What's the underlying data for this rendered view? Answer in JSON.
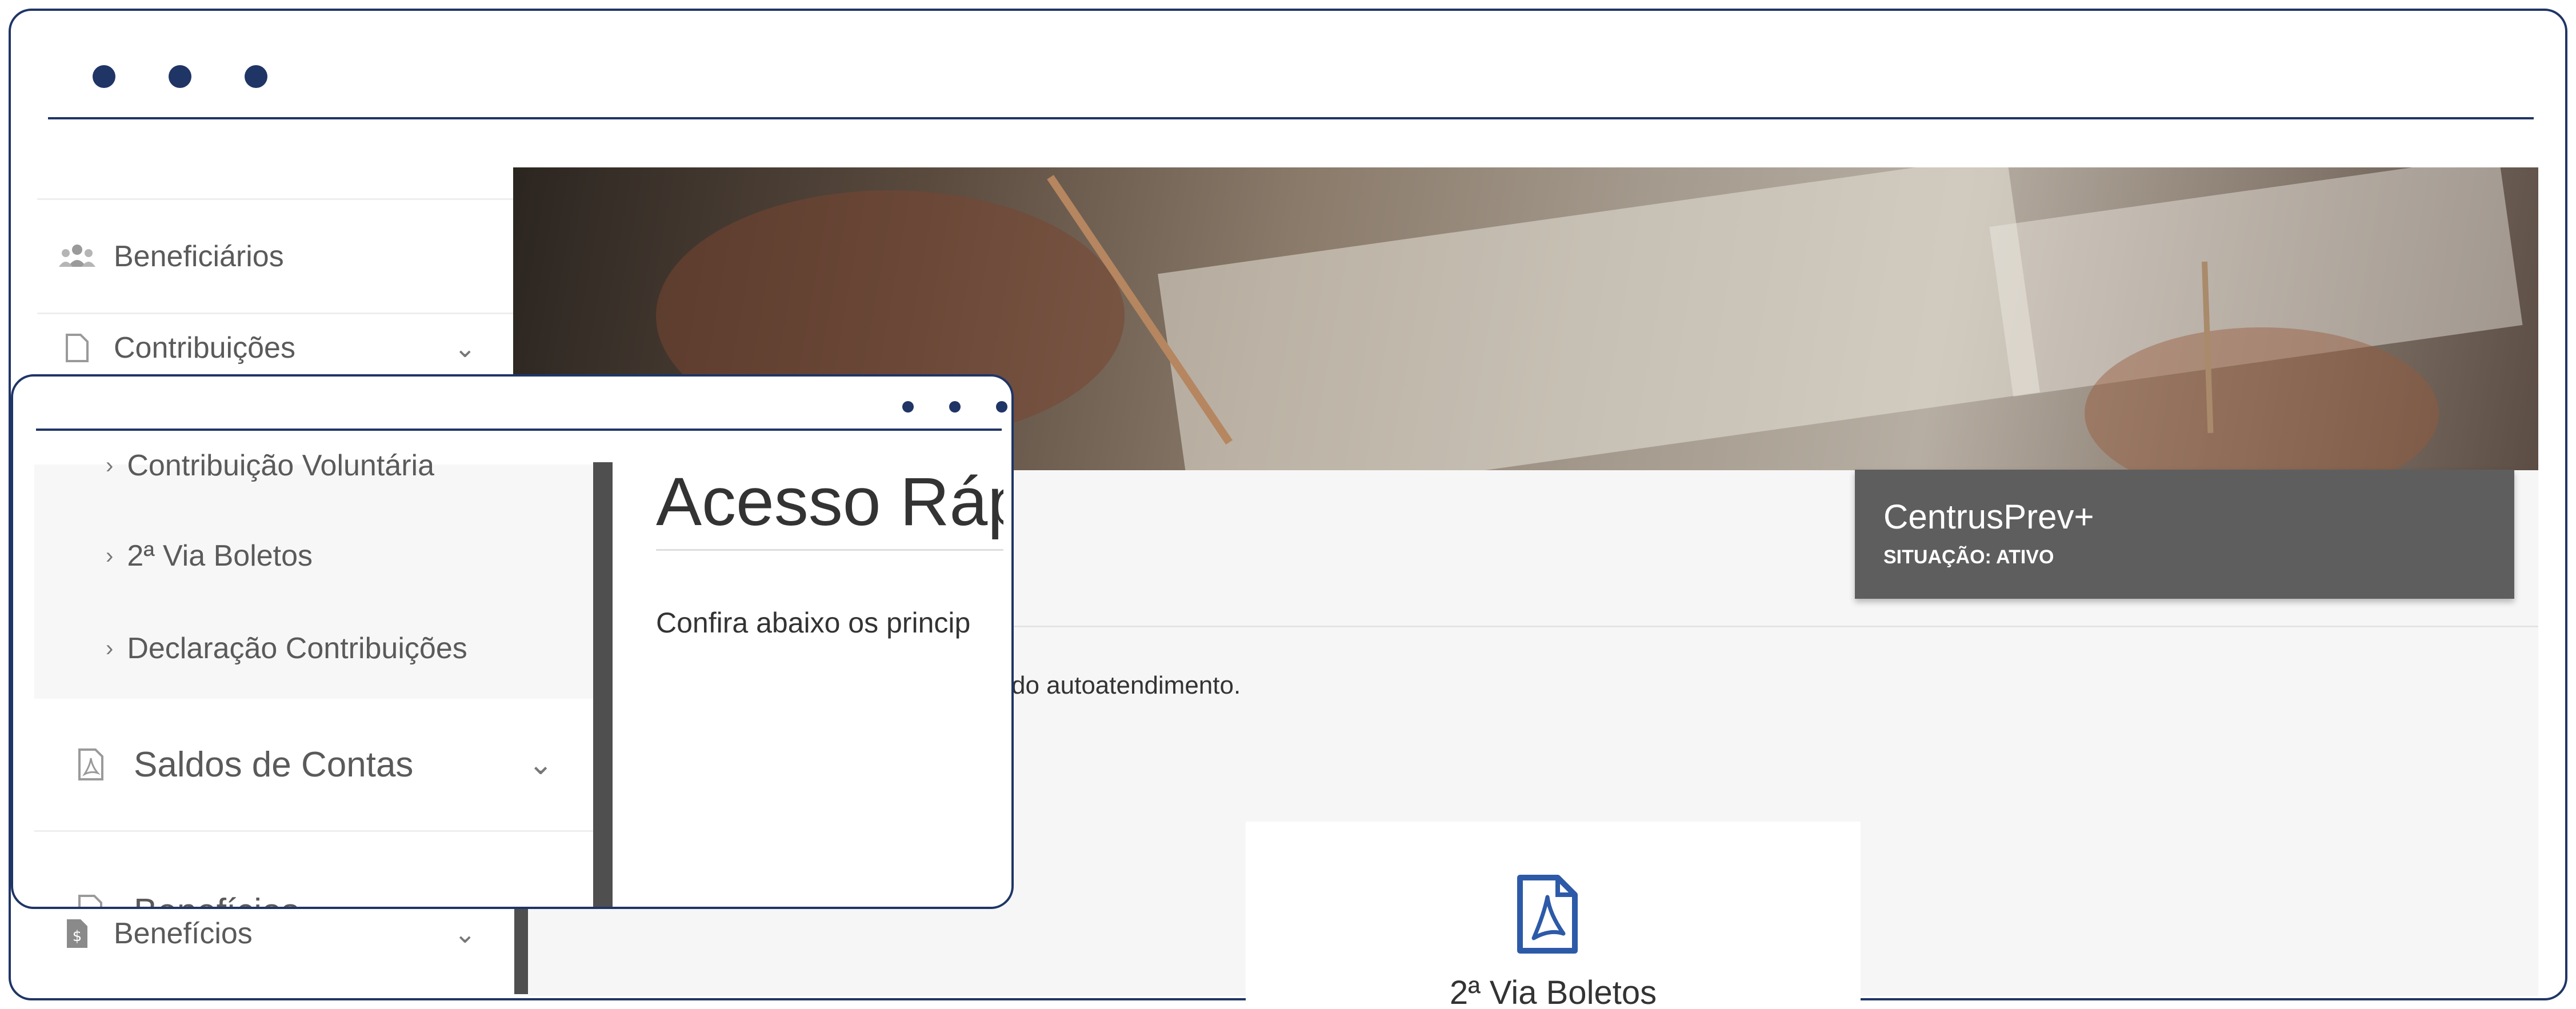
{
  "colors": {
    "frame": "#1f3566",
    "card_bg": "#5e5e5e",
    "pdf_blue": "#2d5aa8"
  },
  "background_sidebar": {
    "items": [
      {
        "label": "Beneficiários",
        "icon": "users-icon",
        "chevron": false
      },
      {
        "label": "Contribuições",
        "icon": "document-icon",
        "chevron": true
      },
      {
        "label": "Benefícios",
        "icon": "money-document-icon",
        "chevron": true
      }
    ]
  },
  "inner_window": {
    "sidebar": {
      "sub_items": [
        {
          "label": "Contribuição Voluntária"
        },
        {
          "label": "2ª Via Boletos"
        },
        {
          "label": "Declaração Contribuições"
        }
      ],
      "saldos": {
        "label": "Saldos de Contas",
        "icon": "pdf-file-icon"
      },
      "beneficios": {
        "label": "Benefícios"
      }
    },
    "content": {
      "title": "Acesso Ráp",
      "description": "Confira abaixo os princip"
    }
  },
  "main": {
    "plan_card": {
      "plan_name": "CentrusPrev+",
      "status": "SITUAÇÃO: ATIVO"
    },
    "intro_tail": "do autoatendimento.",
    "quick_access": {
      "label": "2ª Via Boletos",
      "icon": "pdf-icon"
    }
  }
}
